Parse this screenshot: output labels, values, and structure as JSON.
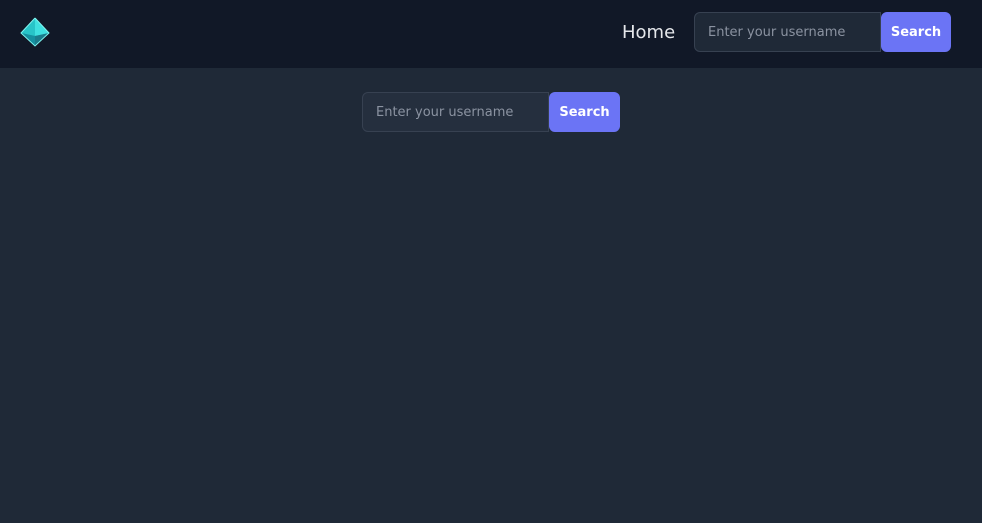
{
  "navbar": {
    "logo_icon": "diamond-logo-icon",
    "links": [
      {
        "label": "Home"
      }
    ],
    "search": {
      "placeholder": "Enter your username",
      "value": "",
      "button_label": "Search"
    }
  },
  "main": {
    "search": {
      "placeholder": "Enter your username",
      "value": "",
      "button_label": "Search"
    }
  },
  "colors": {
    "navbar_bg": "#111827",
    "page_bg": "#1f2937",
    "accent": "#6b74f5",
    "logo": "#2dd4d4"
  }
}
